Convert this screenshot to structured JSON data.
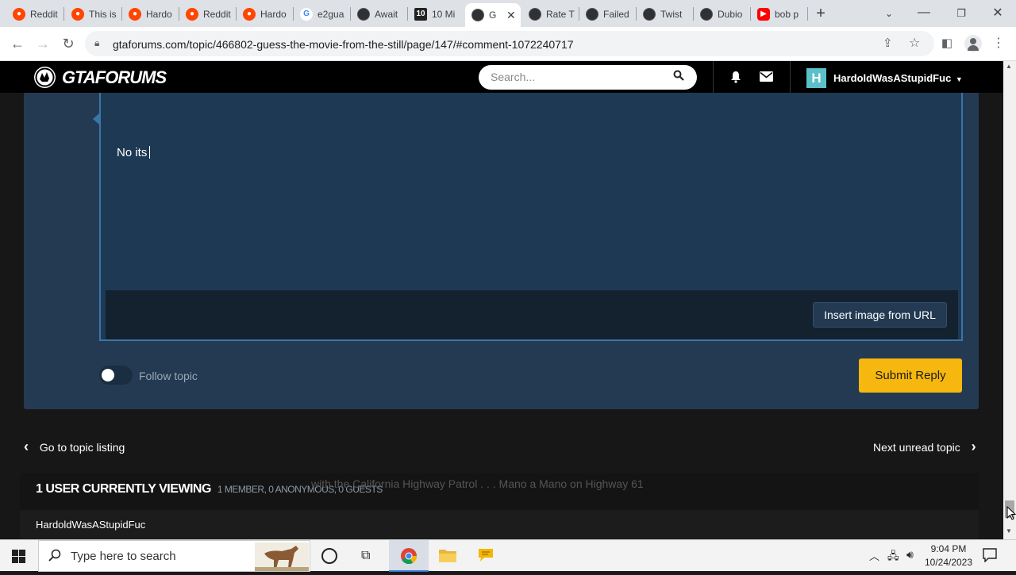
{
  "browser": {
    "tabs": [
      {
        "title": "Reddit",
        "icon": "reddit-icon"
      },
      {
        "title": "This is",
        "icon": "reddit-icon"
      },
      {
        "title": "Hardo",
        "icon": "reddit-icon"
      },
      {
        "title": "Reddit",
        "icon": "reddit-icon"
      },
      {
        "title": "Hardo",
        "icon": "reddit-icon"
      },
      {
        "title": "e2gua",
        "icon": "google-icon"
      },
      {
        "title": "Await",
        "icon": "gtaforums-icon"
      },
      {
        "title": "10 Mi",
        "icon": "imdb-icon"
      },
      {
        "title": "G",
        "icon": "gtaforums-icon",
        "active": true
      },
      {
        "title": "Rate T",
        "icon": "gtaforums-icon"
      },
      {
        "title": "Failed",
        "icon": "gtaforums-icon"
      },
      {
        "title": "Twist",
        "icon": "gtaforums-icon"
      },
      {
        "title": "Dubio",
        "icon": "gtaforums-icon"
      },
      {
        "title": "bob p",
        "icon": "youtube-icon"
      }
    ],
    "url": "gtaforums.com/topic/466802-guess-the-movie-from-the-still/page/147/#comment-1072240717"
  },
  "site": {
    "logo_text": "GTAFORUMS",
    "search_placeholder": "Search...",
    "user_initial": "H",
    "username": "HardoldWasAStupidFuc"
  },
  "editor": {
    "text": "No its",
    "insert_image_label": "Insert image from URL",
    "follow_label": "Follow topic",
    "submit_label": "Submit Reply"
  },
  "nav": {
    "prev_label": "Go to topic listing",
    "next_label": "Next unread topic"
  },
  "viewing": {
    "title": "1 USER CURRENTLY VIEWING",
    "subtitle": "1 MEMBER, 0 ANONYMOUS, 0 GUESTS",
    "users": [
      "HardoldWasAStupidFuc"
    ]
  },
  "overlap_text": "with the California Highway Patrol . . . Mano a Mano on Highway 61",
  "taskbar": {
    "search_placeholder": "Type here to search",
    "time": "9:04 PM",
    "date": "10/24/2023"
  }
}
